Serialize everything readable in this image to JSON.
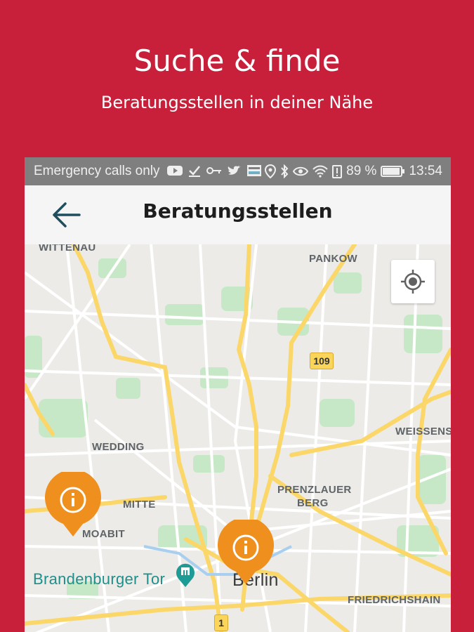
{
  "hero": {
    "title": "Suche & finde",
    "subtitle": "Beratungsstellen in deiner Nähe"
  },
  "statusbar": {
    "carrier": "Emergency calls only",
    "battery": "89 %",
    "time": "13:54"
  },
  "appbar": {
    "title": "Beratungsstellen"
  },
  "map": {
    "labels": {
      "wittenau": "WITTENAU",
      "pankow": "PANKOW",
      "wedding": "WEDDING",
      "weissensee": "WEISSENSE",
      "mitte": "MITTE",
      "prenzlauer": "PRENZLAUER",
      "berg": "BERG",
      "moabit": "MOABIT",
      "brandenburger": "Brandenburger Tor",
      "berlin": "Berlin",
      "friedrichshain": "FRIEDRICHSHAIN",
      "route109": "109",
      "route1": "1"
    },
    "pin_icon": "info-icon"
  },
  "colors": {
    "brand": "#c8203a",
    "pin": "#ef8f1e",
    "road_major": "#fbd76a",
    "park": "#c6e8c6"
  }
}
